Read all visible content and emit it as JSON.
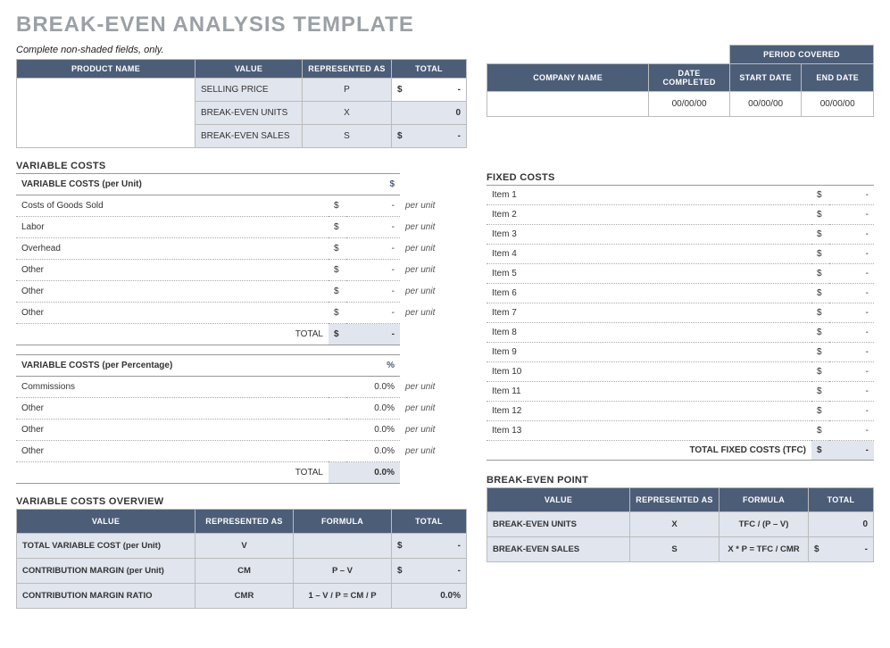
{
  "title": "BREAK-EVEN ANALYSIS TEMPLATE",
  "instruction": "Complete non-shaded fields, only.",
  "product_table": {
    "headers": {
      "name": "PRODUCT NAME",
      "value": "VALUE",
      "rep": "REPRESENTED AS",
      "total": "TOTAL"
    },
    "rows": [
      {
        "value": "SELLING PRICE",
        "rep": "P",
        "cur": "$",
        "total": "-"
      },
      {
        "value": "BREAK-EVEN UNITS",
        "rep": "X",
        "cur": "",
        "total": "0"
      },
      {
        "value": "BREAK-EVEN SALES",
        "rep": "S",
        "cur": "$",
        "total": "-"
      }
    ]
  },
  "right_header": {
    "company": "COMPANY NAME",
    "date_completed": "DATE COMPLETED",
    "period": "PERIOD   COVERED",
    "start": "START DATE",
    "end": "END DATE",
    "vals": {
      "company": "",
      "date": "00/00/00",
      "start": "00/00/00",
      "end": "00/00/00"
    }
  },
  "var_costs": {
    "title": "VARIABLE COSTS",
    "unit_title": "VARIABLE COSTS (per Unit)",
    "unit_sign": "$",
    "unit_rows": [
      {
        "label": "Costs of Goods Sold",
        "cur": "$",
        "val": "-",
        "unit": "per unit"
      },
      {
        "label": "Labor",
        "cur": "$",
        "val": "-",
        "unit": "per unit"
      },
      {
        "label": "Overhead",
        "cur": "$",
        "val": "-",
        "unit": "per unit"
      },
      {
        "label": "Other",
        "cur": "$",
        "val": "-",
        "unit": "per unit"
      },
      {
        "label": "Other",
        "cur": "$",
        "val": "-",
        "unit": "per unit"
      },
      {
        "label": "Other",
        "cur": "$",
        "val": "-",
        "unit": "per unit"
      }
    ],
    "unit_total_label": "TOTAL",
    "unit_total_cur": "$",
    "unit_total_val": "-",
    "pct_title": "VARIABLE COSTS (per Percentage)",
    "pct_sign": "%",
    "pct_rows": [
      {
        "label": "Commissions",
        "val": "0.0%",
        "unit": "per unit"
      },
      {
        "label": "Other",
        "val": "0.0%",
        "unit": "per unit"
      },
      {
        "label": "Other",
        "val": "0.0%",
        "unit": "per unit"
      },
      {
        "label": "Other",
        "val": "0.0%",
        "unit": "per unit"
      }
    ],
    "pct_total_label": "TOTAL",
    "pct_total_val": "0.0%"
  },
  "fixed_costs": {
    "title": "FIXED COSTS",
    "rows": [
      {
        "label": "Item 1",
        "cur": "$",
        "val": "-"
      },
      {
        "label": "Item 2",
        "cur": "$",
        "val": "-"
      },
      {
        "label": "Item 3",
        "cur": "$",
        "val": "-"
      },
      {
        "label": "Item 4",
        "cur": "$",
        "val": "-"
      },
      {
        "label": "Item 5",
        "cur": "$",
        "val": "-"
      },
      {
        "label": "Item 6",
        "cur": "$",
        "val": "-"
      },
      {
        "label": "Item 7",
        "cur": "$",
        "val": "-"
      },
      {
        "label": "Item 8",
        "cur": "$",
        "val": "-"
      },
      {
        "label": "Item 9",
        "cur": "$",
        "val": "-"
      },
      {
        "label": "Item 10",
        "cur": "$",
        "val": "-"
      },
      {
        "label": "Item 11",
        "cur": "$",
        "val": "-"
      },
      {
        "label": "Item 12",
        "cur": "$",
        "val": "-"
      },
      {
        "label": "Item 13",
        "cur": "$",
        "val": "-"
      }
    ],
    "total_label": "TOTAL FIXED COSTS (TFC)",
    "total_cur": "$",
    "total_val": "-"
  },
  "overview": {
    "title": "VARIABLE COSTS OVERVIEW",
    "headers": {
      "value": "VALUE",
      "rep": "REPRESENTED AS",
      "formula": "FORMULA",
      "total": "TOTAL"
    },
    "rows": [
      {
        "value": "TOTAL VARIABLE COST (per Unit)",
        "rep": "V",
        "formula": "",
        "cur": "$",
        "total": "-"
      },
      {
        "value": "CONTRIBUTION MARGIN (per Unit)",
        "rep": "CM",
        "formula": "P – V",
        "cur": "$",
        "total": "-"
      },
      {
        "value": "CONTRIBUTION MARGIN RATIO",
        "rep": "CMR",
        "formula": "1 – V / P = CM / P",
        "cur": "",
        "total": "0.0%"
      }
    ]
  },
  "breakeven": {
    "title": "BREAK-EVEN POINT",
    "headers": {
      "value": "VALUE",
      "rep": "REPRESENTED AS",
      "formula": "FORMULA",
      "total": "TOTAL"
    },
    "rows": [
      {
        "value": "BREAK-EVEN UNITS",
        "rep": "X",
        "formula": "TFC / (P – V)",
        "cur": "",
        "total": "0"
      },
      {
        "value": "BREAK-EVEN SALES",
        "rep": "S",
        "formula": "X * P = TFC / CMR",
        "cur": "$",
        "total": "-"
      }
    ]
  }
}
